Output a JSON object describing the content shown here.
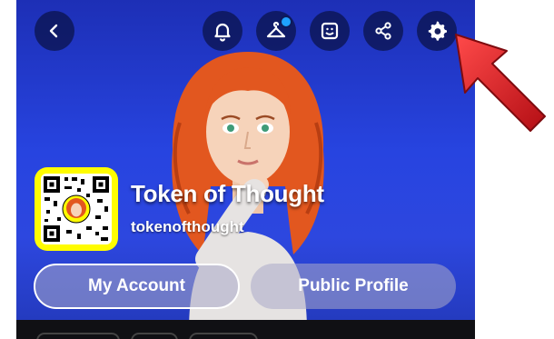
{
  "profile": {
    "display_name": "Token of Thought",
    "username": "tokenofthought"
  },
  "actions": {
    "my_account_label": "My Account",
    "public_profile_label": "Public Profile"
  },
  "header_icons": [
    "back-icon",
    "bell-icon",
    "hanger-icon",
    "sticker-icon",
    "share-icon",
    "gear-icon"
  ],
  "colors": {
    "background_blue": "#2744e0",
    "snapcode_yellow": "#fffc00",
    "notification_dot": "#1ea1ff",
    "arrow_red": "#d8141b"
  }
}
